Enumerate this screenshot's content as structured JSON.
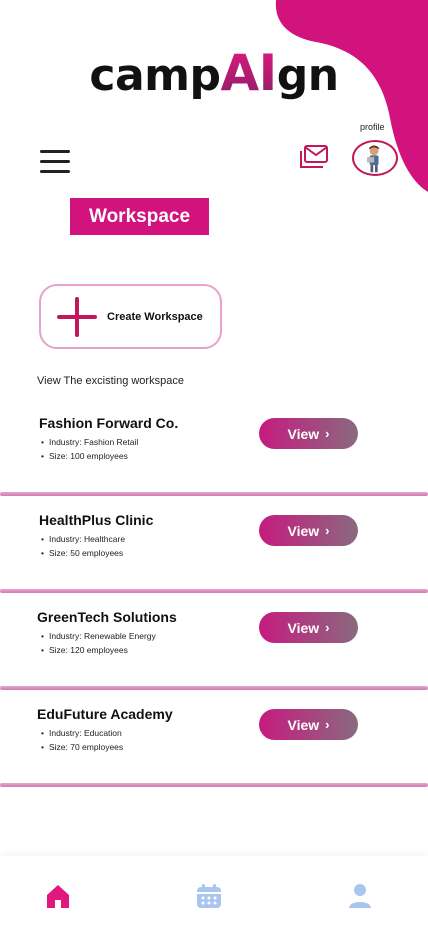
{
  "app": {
    "logo_prefix": "camp",
    "logo_ai": "AI",
    "logo_suffix": "gn"
  },
  "header": {
    "profile_label": "profile",
    "menu_icon": "hamburger-icon",
    "mail_icon": "mail-icon"
  },
  "page": {
    "title": "Workspace",
    "create_label": "Create Workspace",
    "section_label": "View The excisting workspace"
  },
  "workspaces": [
    {
      "name": "Fashion Forward Co.",
      "industry": "Industry: Fashion Retail",
      "size": "Size: 100 employees",
      "action": "View"
    },
    {
      "name": "HealthPlus Clinic",
      "industry": "Industry: Healthcare",
      "size": "Size: 50 employees",
      "action": "View"
    },
    {
      "name": "GreenTech Solutions",
      "industry": "Industry: Renewable Energy",
      "size": "Size: 120 employees",
      "action": "View"
    },
    {
      "name": "EduFuture Academy",
      "industry": "Industry: Education",
      "size": "Size: 70 employees",
      "action": "View"
    }
  ],
  "bottom_nav": {
    "items": [
      "home-icon",
      "calendar-icon",
      "user-icon"
    ],
    "active": "home-icon"
  },
  "colors": {
    "accent": "#d2127d",
    "home_active": "#e0187f",
    "nav_inactive": "#a9c6f0"
  }
}
